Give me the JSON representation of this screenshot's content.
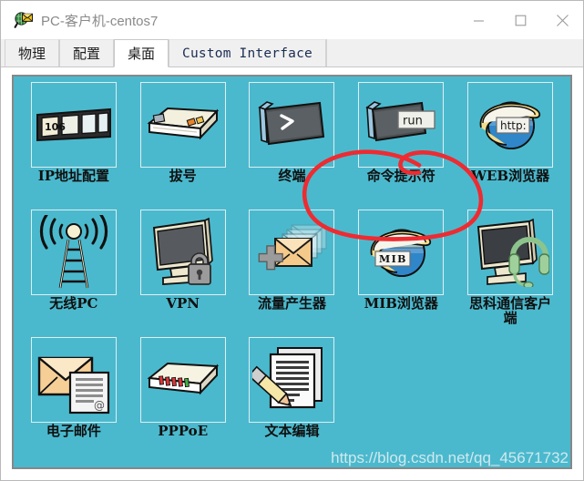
{
  "window": {
    "title": "PC-客户机-centos7",
    "app_icon": "packet-tracer-envelope-magnifier-icon",
    "controls": {
      "minimize": "minimize-icon",
      "maximize": "maximize-icon",
      "close": "close-icon"
    }
  },
  "tabs": [
    {
      "label": "物理",
      "script": "cjk",
      "active": false
    },
    {
      "label": "配置",
      "script": "cjk",
      "active": false
    },
    {
      "label": "桌面",
      "script": "cjk",
      "active": true
    },
    {
      "label": "Custom Interface",
      "script": "latin",
      "active": false
    }
  ],
  "desktop": {
    "background_color": "#4bb9cd",
    "border_color": "#86888a",
    "items": [
      {
        "label": "IP地址配置",
        "icon": "ip-configuration-icon",
        "badge": "106"
      },
      {
        "label": "拔号",
        "icon": "dial-up-modem-icon",
        "badge": ""
      },
      {
        "label": "终端",
        "icon": "terminal-icon",
        "badge": ">"
      },
      {
        "label": "命令提示符",
        "icon": "command-prompt-icon",
        "badge": "run"
      },
      {
        "label": "WEB浏览器",
        "icon": "web-browser-icon",
        "badge": "http:"
      },
      {
        "label": "无线PC",
        "icon": "wireless-pc-antenna-icon",
        "badge": ""
      },
      {
        "label": "VPN",
        "icon": "vpn-monitor-lock-icon",
        "badge": ""
      },
      {
        "label": "流量产生器",
        "icon": "traffic-generator-envelopes-icon",
        "badge": ""
      },
      {
        "label": "MIB浏览器",
        "icon": "mib-browser-icon",
        "badge": "MIB"
      },
      {
        "label": "思科通信客户端",
        "icon": "cisco-ip-communicator-headset-icon",
        "badge": ""
      },
      {
        "label": "电子邮件",
        "icon": "email-envelope-document-icon",
        "badge": ""
      },
      {
        "label": "PPPoE",
        "icon": "pppoe-router-icon",
        "badge": ""
      },
      {
        "label": "文本编辑",
        "icon": "text-editor-pencil-icon",
        "badge": ""
      }
    ]
  },
  "annotation": {
    "shape": "hand-drawn-red-ellipse",
    "color": "#ee2b31",
    "target_label": "命令提示符"
  },
  "watermark": {
    "text": "https://blog.csdn.net/qq_45671732",
    "color": "#cfe9ef"
  }
}
